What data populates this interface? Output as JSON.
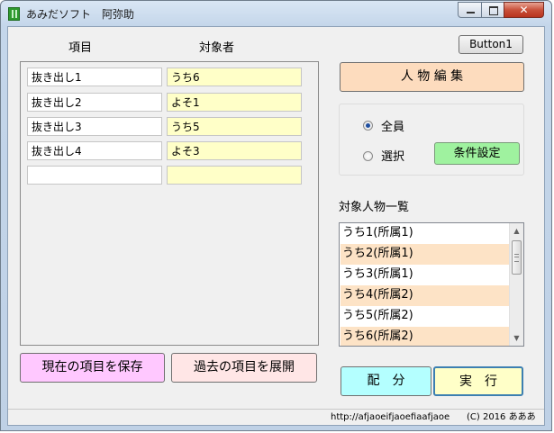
{
  "window": {
    "title": "あみだソフト　阿弥助"
  },
  "headers": {
    "item": "項目",
    "target": "対象者"
  },
  "toolbar": {
    "button1_label": "Button1"
  },
  "rows": [
    {
      "item": "抜き出し1",
      "target": "うち6"
    },
    {
      "item": "抜き出し2",
      "target": "よそ1"
    },
    {
      "item": "抜き出し3",
      "target": "うち5"
    },
    {
      "item": "抜き出し4",
      "target": "よそ3"
    },
    {
      "item": "",
      "target": ""
    }
  ],
  "buttons": {
    "save": "現在の項目を保存",
    "load": "過去の項目を展開",
    "edit_people": "人 物 編 集",
    "condition": "条件設定",
    "distribute": "配　分",
    "execute": "実　行"
  },
  "radios": {
    "all": "全員",
    "select": "選択",
    "selected": "all"
  },
  "people_list": {
    "label": "対象人物一覧",
    "items": [
      "うち1(所属1)",
      "うち2(所属1)",
      "うち3(所属1)",
      "うち4(所属2)",
      "うち5(所属2)",
      "うち6(所属2)"
    ]
  },
  "status": {
    "url": "http://afjaoeifjaoefiaafjaoe",
    "copyright": "(C) 2016 あああ"
  },
  "colors": {
    "save_button": "#ffc8ff",
    "load_button": "#ffe6e6",
    "edit_button": "#fddcbe",
    "condition_button": "#9ff29f",
    "distribute_button": "#b4ffff",
    "execute_button": "#ffffc8",
    "target_field": "#ffffc8",
    "list_alt_row": "#fde3c6"
  }
}
